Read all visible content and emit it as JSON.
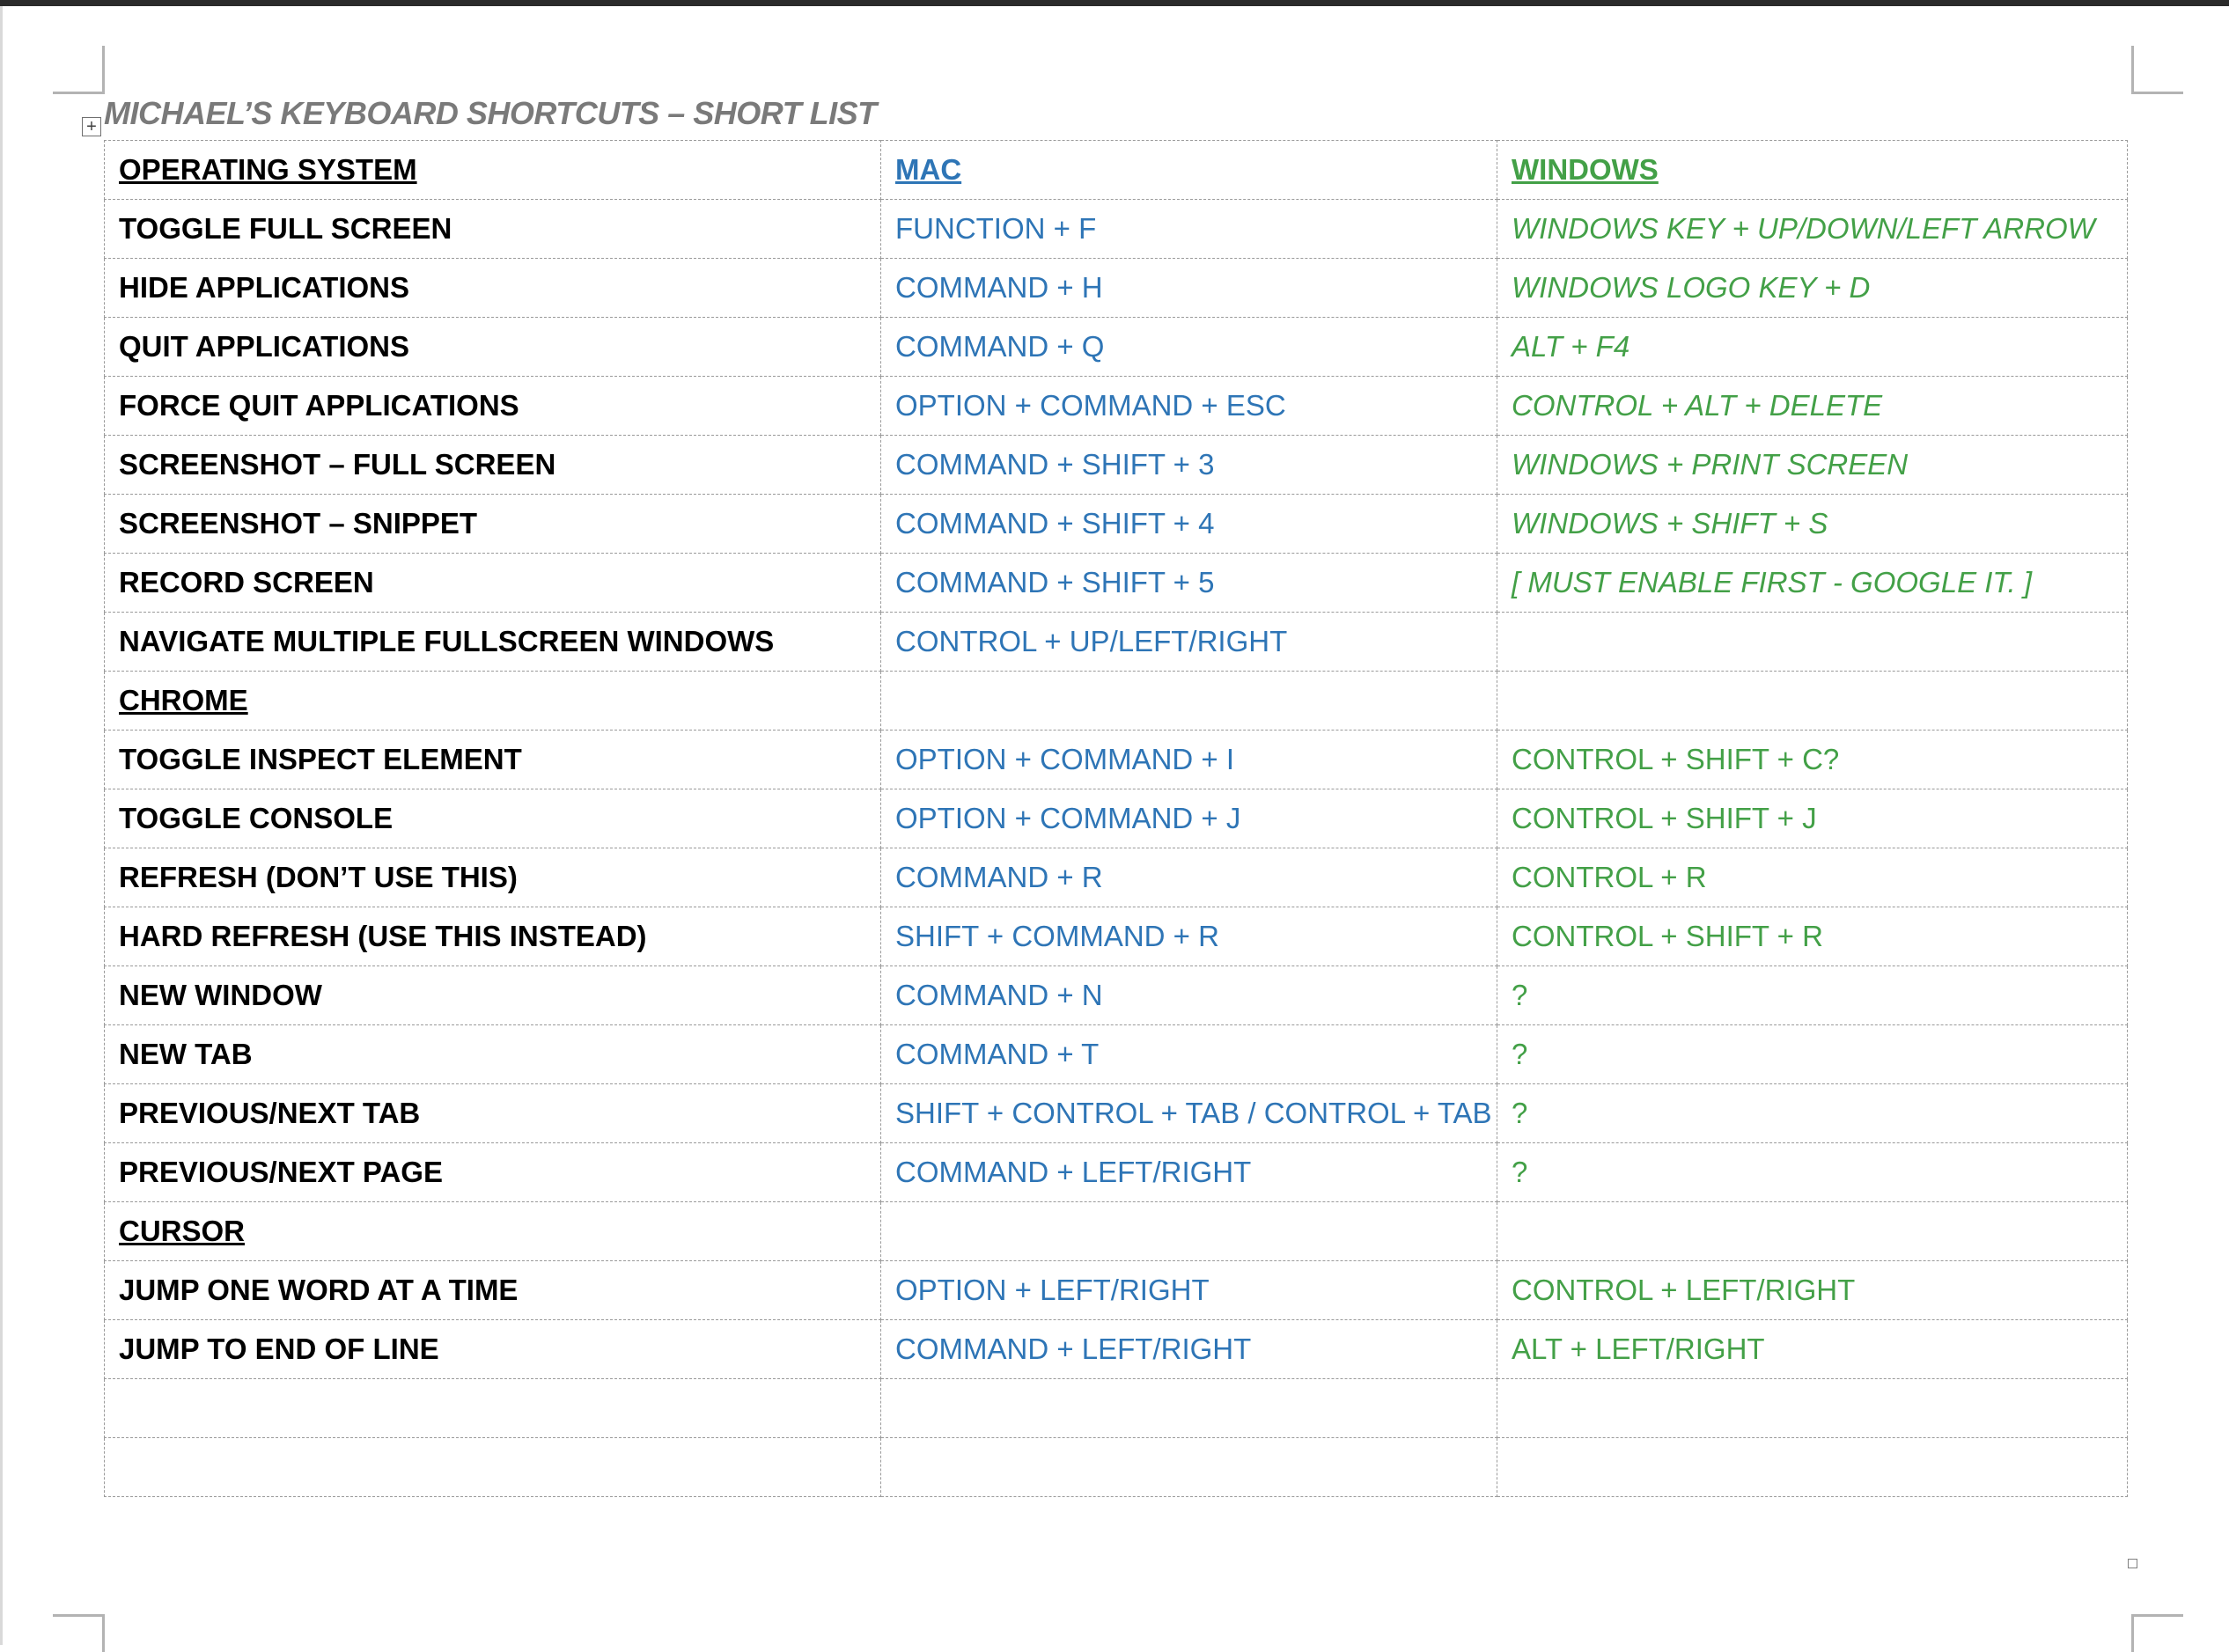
{
  "document": {
    "title": "MICHAEL’S KEYBOARD SHORTCUTS – SHORT LIST"
  },
  "table": {
    "sections": [
      {
        "name": "OPERATING SYSTEM",
        "mac_header": "MAC",
        "windows_header": "WINDOWS",
        "rows": [
          {
            "action": "TOGGLE FULL SCREEN",
            "mac": "FUNCTION + F",
            "windows": "WINDOWS KEY + UP/DOWN/LEFT ARROW"
          },
          {
            "action": "HIDE APPLICATIONS",
            "mac": "COMMAND + H",
            "windows": "WINDOWS LOGO KEY  + D"
          },
          {
            "action": "QUIT APPLICATIONS",
            "mac": "COMMAND + Q",
            "windows": "ALT + F4"
          },
          {
            "action": "FORCE QUIT APPLICATIONS",
            "mac": "OPTION + COMMAND + ESC",
            "windows": "CONTROL + ALT + DELETE"
          },
          {
            "action": "SCREENSHOT – FULL SCREEN",
            "mac": "COMMAND + SHIFT + 3",
            "windows": "WINDOWS + PRINT SCREEN"
          },
          {
            "action": "SCREENSHOT – SNIPPET",
            "mac": "COMMAND + SHIFT + 4",
            "windows": "WINDOWS + SHIFT + S"
          },
          {
            "action": "RECORD SCREEN",
            "mac": "COMMAND + SHIFT + 5",
            "windows": "[ MUST ENABLE FIRST - GOOGLE IT. ]"
          },
          {
            "action": "NAVIGATE MULTIPLE FULLSCREEN WINDOWS",
            "mac": "CONTROL + UP/LEFT/RIGHT",
            "windows": ""
          }
        ]
      },
      {
        "name": "CHROME",
        "mac_header": "",
        "windows_header": "",
        "rows": [
          {
            "action": "TOGGLE INSPECT ELEMENT",
            "mac": "OPTION + COMMAND + I",
            "windows": "CONTROL + SHIFT + C?"
          },
          {
            "action": "TOGGLE CONSOLE",
            "mac": "OPTION + COMMAND + J",
            "windows": "CONTROL + SHIFT + J"
          },
          {
            "action": "REFRESH (DON’T USE THIS)",
            "mac": "COMMAND + R",
            "windows": "CONTROL + R"
          },
          {
            "action": "HARD REFRESH (USE THIS INSTEAD)",
            "mac": "SHIFT + COMMAND + R",
            "windows": "CONTROL + SHIFT + R"
          },
          {
            "action": "NEW WINDOW",
            "mac": "COMMAND + N",
            "windows": "?"
          },
          {
            "action": "NEW TAB",
            "mac": "COMMAND + T",
            "windows": "?"
          },
          {
            "action": "PREVIOUS/NEXT TAB",
            "mac": "SHIFT + CONTROL + TAB / CONTROL + TAB",
            "windows": "?"
          },
          {
            "action": "PREVIOUS/NEXT PAGE",
            "mac": "COMMAND + LEFT/RIGHT",
            "windows": "?"
          }
        ]
      },
      {
        "name": "CURSOR",
        "mac_header": "",
        "windows_header": "",
        "rows": [
          {
            "action": "JUMP ONE WORD AT A TIME",
            "mac": "OPTION + LEFT/RIGHT",
            "windows": "CONTROL + LEFT/RIGHT"
          },
          {
            "action": "JUMP TO END OF LINE",
            "mac": "COMMAND + LEFT/RIGHT",
            "windows": "ALT + LEFT/RIGHT"
          },
          {
            "action": "",
            "mac": "",
            "windows": ""
          },
          {
            "action": "",
            "mac": "",
            "windows": ""
          }
        ]
      }
    ]
  },
  "icons": {
    "table_move_handle": "table-move-handle-icon",
    "table_resize_handle": "table-resize-handle-icon"
  },
  "colors": {
    "mac_text": "#2e75b6",
    "windows_text": "#43a047",
    "title_text": "#7a7a7a"
  }
}
